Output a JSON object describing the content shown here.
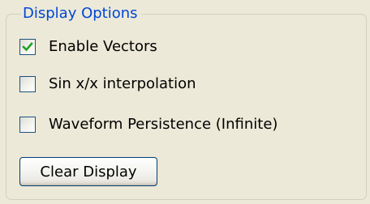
{
  "group": {
    "title": "Display Options"
  },
  "options": [
    {
      "label": "Enable Vectors",
      "checked": true
    },
    {
      "label": "Sin x/x interpolation",
      "checked": false
    },
    {
      "label": "Waveform Persistence (Infinite)",
      "checked": false
    }
  ],
  "clear_button": {
    "label": "Clear Display"
  },
  "colors": {
    "background": "#ece9d8",
    "legend_text": "#0046d5",
    "checkmark": "#21a121",
    "checkbox_border": "#1c5180",
    "button_border": "#003c74"
  }
}
